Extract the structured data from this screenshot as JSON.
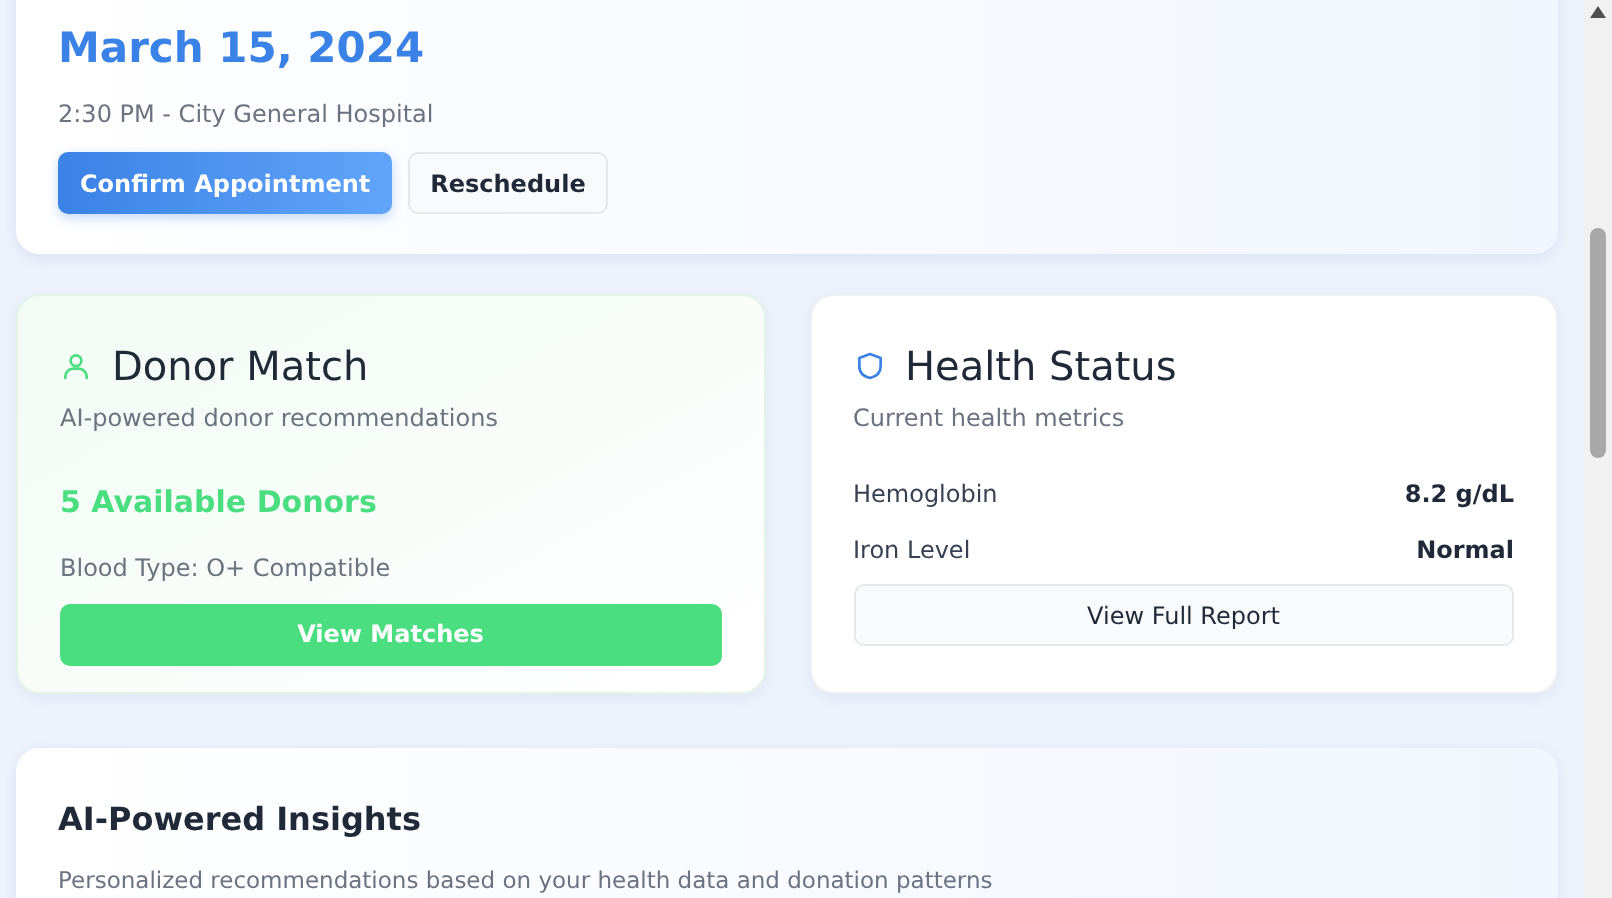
{
  "appointment": {
    "date": "March 15, 2024",
    "details": "2:30 PM - City General Hospital",
    "buttons": [
      {
        "label": "Confirm Appointment",
        "kind": "primary"
      },
      {
        "label": "Reschedule",
        "kind": "secondary"
      }
    ]
  },
  "donor_match": {
    "title": "Donor Match",
    "subtitle": "AI-powered donor recommendations",
    "count": "5 Available Donors",
    "blood_type": "Blood Type: O+ Compatible",
    "button": "View Matches"
  },
  "health_status": {
    "title": "Health Status",
    "subtitle": "Current health metrics",
    "metrics": [
      {
        "label": "Hemoglobin",
        "value": "8.2 g/dL"
      },
      {
        "label": "Iron Level",
        "value": "Normal"
      }
    ],
    "button": "View Full Report"
  },
  "insights": {
    "title": "AI-Powered Insights",
    "subtitle": "Personalized recommendations based on your health data and donation patterns"
  }
}
